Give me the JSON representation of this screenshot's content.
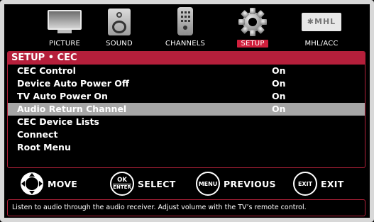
{
  "tabs": [
    {
      "label": "PICTURE",
      "icon": "tv-icon",
      "selected": false
    },
    {
      "label": "SOUND",
      "icon": "speaker-icon",
      "selected": false
    },
    {
      "label": "CHANNELS",
      "icon": "remote-icon",
      "selected": false
    },
    {
      "label": "SETUP",
      "icon": "gear-icon",
      "selected": true
    },
    {
      "label": "MHL/ACC",
      "icon": "mhl-icon",
      "selected": false
    }
  ],
  "mhl_logo_text": "✱MHL",
  "panel": {
    "title": "SETUP • CEC",
    "items": [
      {
        "label": "CEC Control",
        "value": "On"
      },
      {
        "label": "Device Auto Power Off",
        "value": "On"
      },
      {
        "label": "TV Auto Power On",
        "value": "On"
      },
      {
        "label": "Audio Return Channel",
        "value": "On",
        "highlighted": true
      },
      {
        "label": "CEC Device Lists",
        "value": ""
      },
      {
        "label": "Connect",
        "value": ""
      },
      {
        "label": "Root Menu",
        "value": ""
      }
    ]
  },
  "legend": {
    "move": {
      "label": "MOVE"
    },
    "select": {
      "button": "OK\nENTER",
      "label": "SELECT"
    },
    "previous": {
      "button": "MENU",
      "label": "PREVIOUS"
    },
    "exit": {
      "button": "EXIT",
      "label": "EXIT"
    }
  },
  "help_text": "Listen to audio through the audio receiver. Adjust volume with the TV’s remote control.",
  "colors": {
    "accent": "#b51f3b",
    "highlight": "#a6a6a6",
    "frame": "#d8d8d8"
  }
}
